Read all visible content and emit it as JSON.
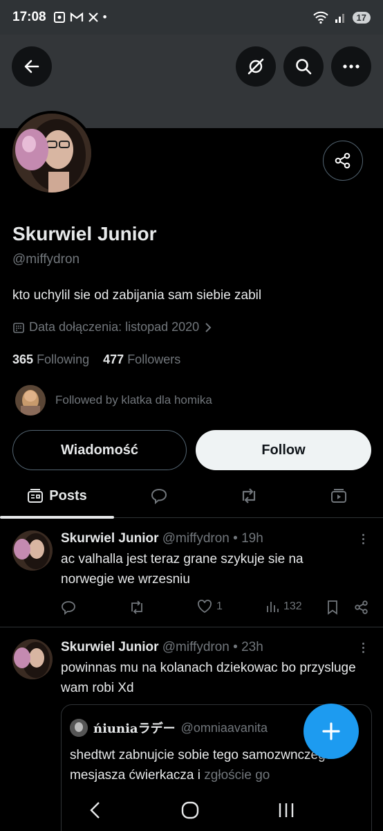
{
  "status_bar": {
    "time": "17:08",
    "app_icons": [
      "screenshot-icon",
      "gmail-icon",
      "x-icon"
    ],
    "dot": "•",
    "battery": "17"
  },
  "profile": {
    "name": "Skurwiel Junior",
    "handle": "@miffydron",
    "bio": "kto uchylil sie od zabijania sam siebie zabil",
    "joined": "Data dołączenia: listopad 2020",
    "following_count": "365",
    "following_label": "Following",
    "followers_count": "477",
    "followers_label": "Followers",
    "followed_by": "Followed by klatka dla homika"
  },
  "buttons": {
    "message": "Wiadomość",
    "follow": "Follow"
  },
  "tabs": {
    "posts": "Posts"
  },
  "posts": [
    {
      "name": "Skurwiel Junior",
      "handle": "@miffydron",
      "time": "19h",
      "text": "ac valhalla jest teraz grane szykuje sie na norwegie we wrzesniu",
      "likes": "1",
      "views": "132"
    },
    {
      "name": "Skurwiel Junior",
      "handle": "@miffydron",
      "time": "23h",
      "text": "powinnas mu na kolanach dziekowac bo przysluge wam robi Xd",
      "quote": {
        "name": "ńiuniaラデー",
        "handle": "@omniaavanita",
        "text_main": "shedtwt zabnujcie sobie tego samozwnczego mesjasza ćwierkacza i",
        "text_faded": "zgłoście go"
      }
    }
  ],
  "colors": {
    "accent": "#1d9bf0",
    "background": "#000000",
    "banner": "#333639",
    "text_secondary": "#71767b"
  }
}
